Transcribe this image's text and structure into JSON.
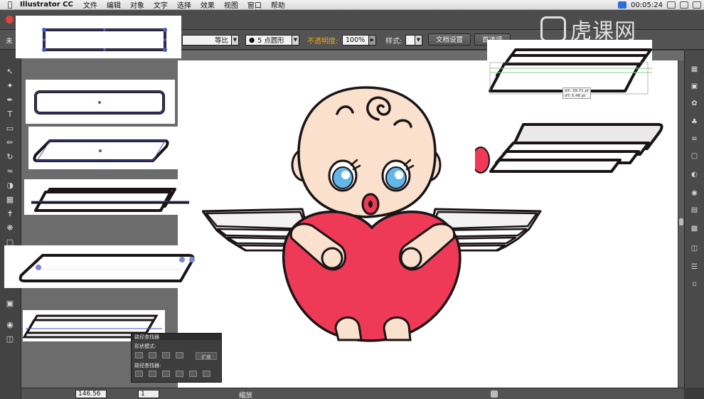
{
  "menubar": {
    "app_name": "Illustrator CC",
    "items": [
      "文件",
      "编辑",
      "对象",
      "文字",
      "选择",
      "效果",
      "视图",
      "窗口",
      "帮助"
    ],
    "clock": "00:05:24"
  },
  "controlbar": {
    "doc_prefix": "未",
    "stroke_profile": "等比",
    "brush": "5 点圆形",
    "opacity_label": "不透明度:",
    "opacity_value": "100%",
    "style_label": "样式:",
    "doc_settings_button": "文档设置",
    "prefs_button": "首选项"
  },
  "watermark": {
    "text": "虎课网"
  },
  "status": {
    "zoom": "146.56",
    "page": "1",
    "mode": "缩放"
  },
  "pathfinder": {
    "title": "路径查找器",
    "shape_modes_label": "形状模式:",
    "pathfinders_label": "路径查找器:",
    "expand_button": "扩展"
  },
  "tooltip": {
    "line1": "dX: 39.71 pt",
    "line2": "dY: 5.48 pt"
  },
  "colors": {
    "ui_dark": "#535353",
    "skin": "#fae1cd",
    "eye_blue": "#63b6ea",
    "heart_red": "#ee3a56",
    "stroke": "#1b1416",
    "selection_blue": "#4a55c6",
    "accent_orange": "#f0a21c"
  }
}
